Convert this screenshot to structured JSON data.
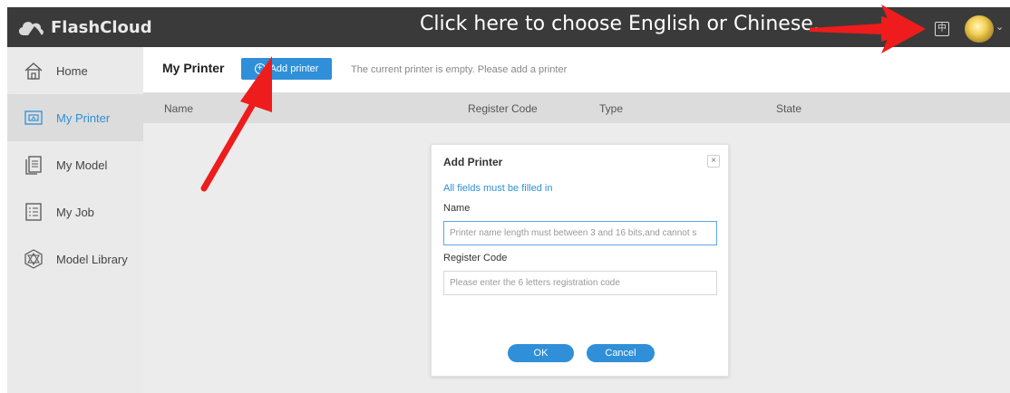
{
  "app": {
    "title": "FlashCloud"
  },
  "annotation": {
    "text": "Click here to choose English or Chinese."
  },
  "topbar": {
    "lang_icon": "中",
    "avatar_caret": "⌄"
  },
  "sidebar": {
    "items": [
      {
        "label": "Home",
        "icon": "home-icon"
      },
      {
        "label": "My Printer",
        "icon": "printer-icon",
        "active": true
      },
      {
        "label": "My Model",
        "icon": "model-icon"
      },
      {
        "label": "My Job",
        "icon": "job-icon"
      },
      {
        "label": "Model Library",
        "icon": "library-icon"
      }
    ]
  },
  "main": {
    "title": "My Printer",
    "add_button": "Add printer",
    "add_icon": "+",
    "empty_message": "The current printer is empty. Please add a printer",
    "columns": [
      "Name",
      "Register Code",
      "Type",
      "State"
    ]
  },
  "modal": {
    "title": "Add Printer",
    "close_label": "×",
    "note": "All fields must be filled in",
    "name_label": "Name",
    "name_placeholder": "Printer name length must between 3 and 16 bits,and cannot s",
    "code_label": "Register Code",
    "code_placeholder": "Please enter the 6 letters registration code",
    "ok": "OK",
    "cancel": "Cancel"
  },
  "colors": {
    "accent": "#2f8fd8",
    "topbar": "#3a3a3a",
    "sidebar": "#eaeaea",
    "arrow": "#ee1c1c"
  }
}
